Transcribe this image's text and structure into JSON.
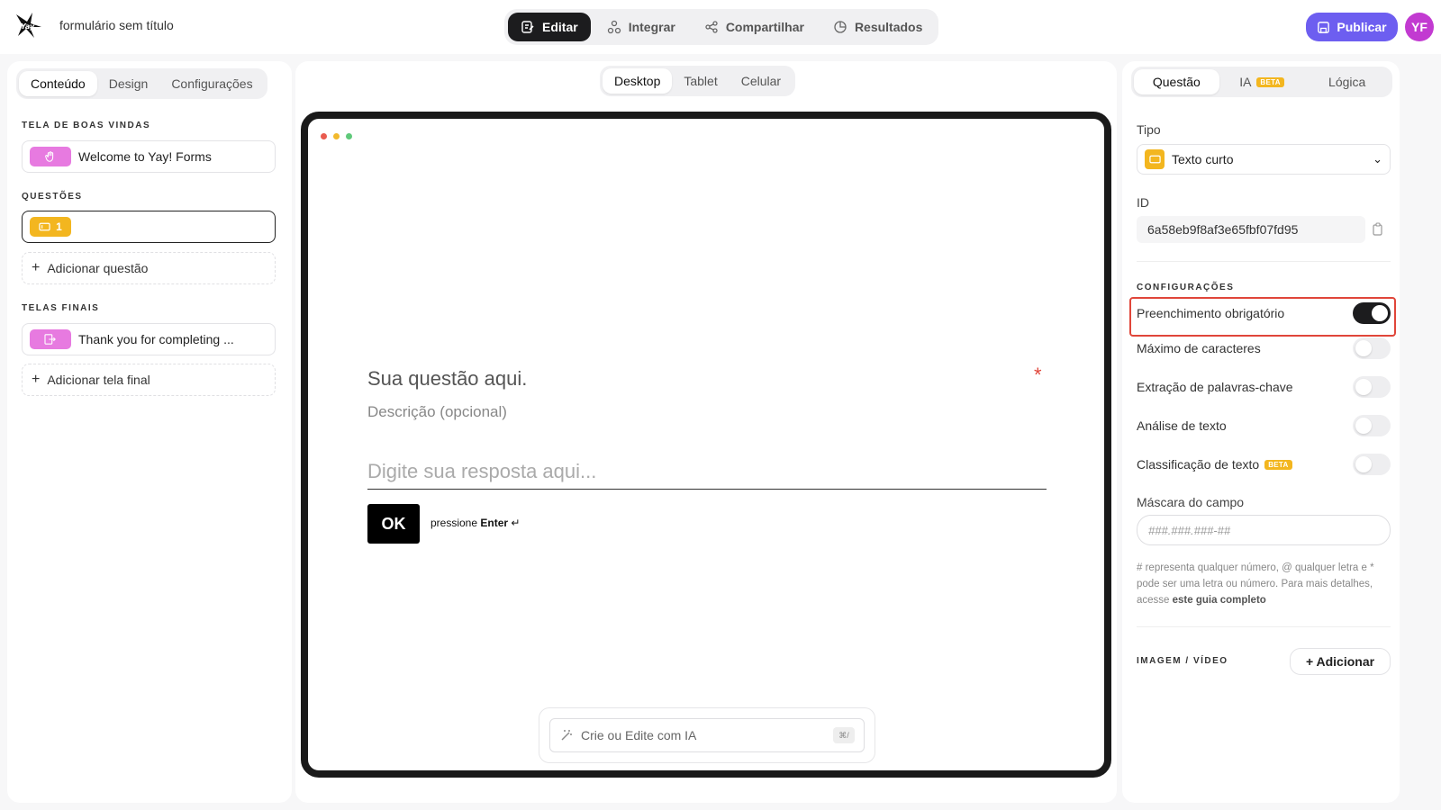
{
  "header": {
    "form_title": "formulário sem título",
    "tabs": [
      {
        "label": "Editar",
        "icon": "edit-icon",
        "active": true
      },
      {
        "label": "Integrar",
        "icon": "integrate-icon",
        "active": false
      },
      {
        "label": "Compartilhar",
        "icon": "share-icon",
        "active": false
      },
      {
        "label": "Resultados",
        "icon": "results-icon",
        "active": false
      }
    ],
    "publish_label": "Publicar",
    "avatar_initials": "YF",
    "colors": {
      "publish": "#6d5ef0",
      "avatar": "#c23ad1"
    }
  },
  "left": {
    "tabs": [
      "Conteúdo",
      "Design",
      "Configurações"
    ],
    "welcome_section": "TELA DE BOAS VINDAS",
    "welcome_item": "Welcome to Yay! Forms",
    "questions_section": "QUESTÕES",
    "question_number": "1",
    "add_question": "Adicionar questão",
    "endings_section": "TELAS FINAIS",
    "ending_item": "Thank you for completing ...",
    "add_ending": "Adicionar tela final"
  },
  "center": {
    "device_tabs": [
      "Desktop",
      "Tablet",
      "Celular"
    ],
    "question_title": "Sua questão aqui.",
    "required_mark": "*",
    "description": "Descrição (opcional)",
    "answer_placeholder": "Digite sua resposta aqui...",
    "ok_label": "OK",
    "press_prefix": "pressione",
    "press_key": "Enter",
    "enter_symbol": "↵",
    "ai_placeholder": "Crie ou Edite com IA",
    "ai_shortcut": "⌘/"
  },
  "right": {
    "tabs": [
      "Questão",
      "IA",
      "Lógica"
    ],
    "beta_label": "BETA",
    "type_label": "Tipo",
    "type_value": "Texto curto",
    "id_label": "ID",
    "id_value": "6a58eb9f8af3e65fbf07fd95",
    "settings_section": "CONFIGURAÇÕES",
    "toggles": [
      {
        "label": "Preenchimento obrigatório",
        "on": true
      },
      {
        "label": "Máximo de caracteres",
        "on": false
      },
      {
        "label": "Extração de palavras-chave",
        "on": false
      },
      {
        "label": "Análise de texto",
        "on": false
      },
      {
        "label": "Classificação de texto",
        "on": false
      }
    ],
    "mask_label": "Máscara do campo",
    "mask_placeholder": "###.###.###-##",
    "help_text_prefix": "# representa qualquer número, @ qualquer letra e * pode ser uma letra ou número. Para mais detalhes, acesse",
    "help_link": "este guia completo",
    "media_section": "IMAGEM / VÍDEO",
    "add_media": "+ Adicionar"
  }
}
